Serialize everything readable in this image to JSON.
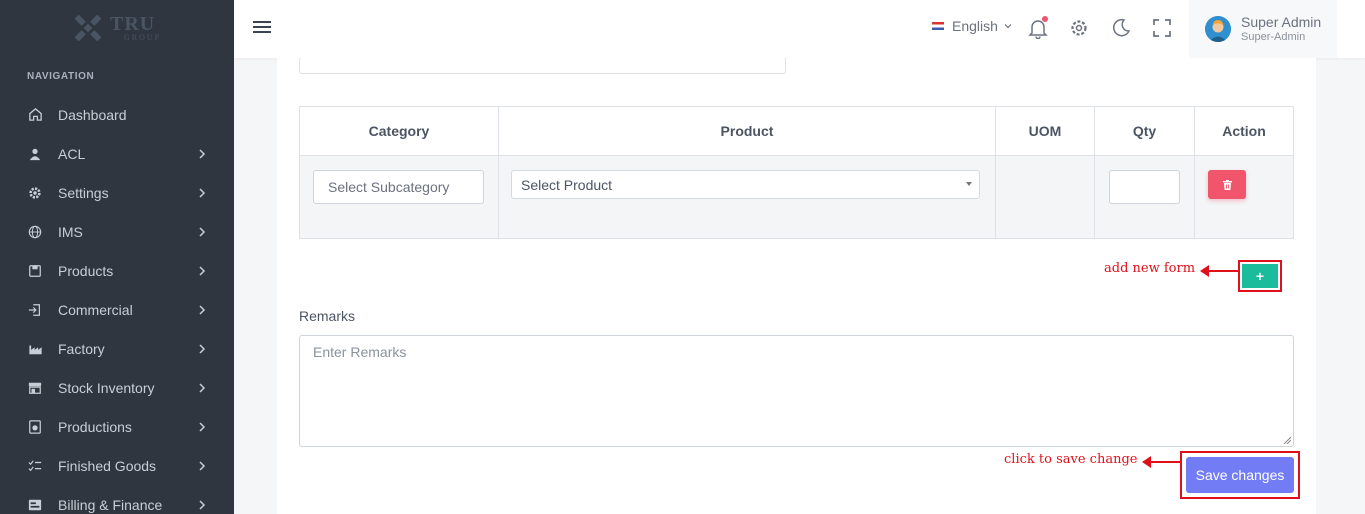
{
  "logo": {
    "text_big": "TRU",
    "text_small": "GROUP"
  },
  "navigation": {
    "heading": "NAVIGATION",
    "items": [
      {
        "label": "Dashboard",
        "icon": "home-icon",
        "has_children": false
      },
      {
        "label": "ACL",
        "icon": "user-icon",
        "has_children": true
      },
      {
        "label": "Settings",
        "icon": "gear-icon",
        "has_children": true
      },
      {
        "label": "IMS",
        "icon": "globe-icon",
        "has_children": true
      },
      {
        "label": "Products",
        "icon": "box-icon",
        "has_children": true
      },
      {
        "label": "Commercial",
        "icon": "login-icon",
        "has_children": true
      },
      {
        "label": "Factory",
        "icon": "factory-icon",
        "has_children": true
      },
      {
        "label": "Stock Inventory",
        "icon": "store-icon",
        "has_children": true
      },
      {
        "label": "Productions",
        "icon": "production-icon",
        "has_children": true
      },
      {
        "label": "Finished Goods",
        "icon": "checklist-icon",
        "has_children": true
      },
      {
        "label": "Billing & Finance",
        "icon": "billing-icon",
        "has_children": true
      }
    ]
  },
  "topbar": {
    "language": "English",
    "user_name": "Super Admin",
    "user_role": "Super-Admin"
  },
  "table": {
    "headers": {
      "category": "Category",
      "product": "Product",
      "uom": "UOM",
      "qty": "Qty",
      "action": "Action"
    },
    "row": {
      "subcategory_placeholder": "Select Subcategory",
      "product_selected": "Select Product",
      "uom": "",
      "qty": ""
    }
  },
  "annotations": {
    "add_form": "add new form",
    "save": "click to save change"
  },
  "add_button_label": "+",
  "remarks": {
    "label": "Remarks",
    "placeholder": "Enter Remarks"
  },
  "save_button_label": "Save changes",
  "colors": {
    "sidebar_bg": "#2f3640",
    "primary": "#727cf5",
    "success": "#1abc9c",
    "danger": "#f1556c",
    "annotation_red": "#e0101a"
  }
}
